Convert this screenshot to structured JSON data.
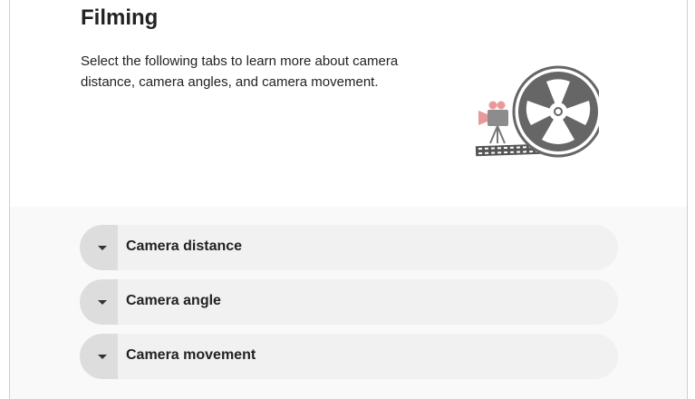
{
  "page": {
    "title": "Filming",
    "intro": "Select the following tabs to learn more about camera distance, camera angles, and camera movement."
  },
  "illustration": {
    "icon": "film-camera-reel-icon",
    "colors": {
      "reel": "#666666",
      "camera_accent": "#e89a9a",
      "camera_body": "#8c8c8c"
    }
  },
  "accordion": {
    "items": [
      {
        "label": "Camera distance",
        "icon": "chevron-down-icon"
      },
      {
        "label": "Camera angle",
        "icon": "chevron-down-icon"
      },
      {
        "label": "Camera movement",
        "icon": "chevron-down-icon"
      }
    ]
  },
  "colors": {
    "accordion_bg": "#f0f1f0",
    "toggle_bg": "#dcdddc",
    "section_bg": "#f8f9f8"
  }
}
